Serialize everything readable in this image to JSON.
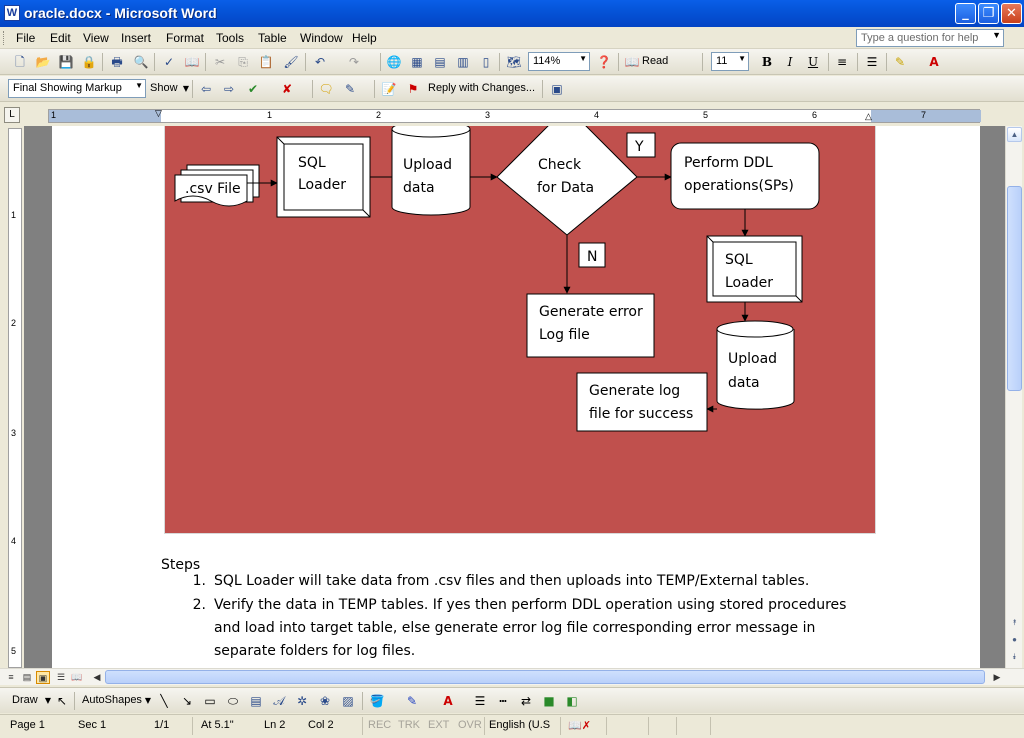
{
  "window": {
    "title": "oracle.docx - Microsoft Word",
    "app_icon": "W",
    "controls": {
      "minimize": "_",
      "restore": "❐",
      "close": "✕"
    }
  },
  "menu": {
    "items": [
      "File",
      "Edit",
      "View",
      "Insert",
      "Format",
      "Tools",
      "Table",
      "Window",
      "Help"
    ],
    "help_placeholder": "Type a question for help"
  },
  "standard_toolbar": {
    "zoom": "114%",
    "read_label": "Read",
    "font_size": "11",
    "bold": "B",
    "italic": "I",
    "underline": "U"
  },
  "reviewing_toolbar": {
    "display": "Final Showing Markup",
    "show_label": "Show",
    "reply_label": "Reply with Changes..."
  },
  "ruler": {
    "numbers": [
      "1",
      "1",
      "2",
      "3",
      "4",
      "5",
      "6",
      "7"
    ]
  },
  "vertical_ruler": {
    "numbers": [
      "1",
      "2",
      "3",
      "4",
      "5"
    ]
  },
  "diagram": {
    "csv_file": ".csv File",
    "sql_loader_1": [
      "SQL",
      "Loader"
    ],
    "upload_data_1": [
      "Upload",
      "data"
    ],
    "check": [
      "Check",
      "for Data"
    ],
    "yes_label": "Y",
    "no_label": "N",
    "perform_ddl": [
      "Perform DDL",
      "operations(SPs)"
    ],
    "sql_loader_2": [
      "SQL",
      "Loader"
    ],
    "generate_error": [
      "Generate error",
      "Log file"
    ],
    "upload_data_2": [
      "Upload",
      "data"
    ],
    "generate_success": [
      "Generate log",
      "file for success"
    ]
  },
  "document": {
    "steps_heading": "Steps",
    "steps": [
      {
        "num": "1.",
        "text": "SQL Loader will take data from .csv files and then uploads into TEMP/External tables."
      },
      {
        "num": "2.",
        "text": "Verify the data in TEMP tables. If yes then perform DDL operation using stored procedures and load into target table, else generate error log file corresponding error message in separate folders for log files."
      }
    ]
  },
  "drawing_toolbar": {
    "draw_label": "Draw",
    "autoshapes_label": "AutoShapes"
  },
  "status": {
    "page": "Page 1",
    "sec": "Sec 1",
    "pages": "1/1",
    "at": "At 5.1\"",
    "ln": "Ln 2",
    "col": "Col 2",
    "rec": "REC",
    "trk": "TRK",
    "ext": "EXT",
    "ovr": "OVR",
    "language": "English (U.S"
  },
  "colors": {
    "figure_background": "#c0504d",
    "title_bar": "#0554d8"
  }
}
